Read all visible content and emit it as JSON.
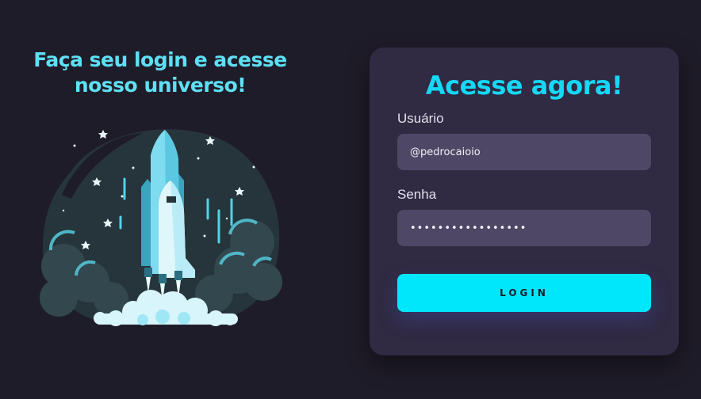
{
  "left": {
    "headline_line1": "Faça seu login e acesse",
    "headline_line2": "nosso universo!",
    "illustration_icon": "rocket-launch-illustration"
  },
  "login_card": {
    "title": "Acesse agora!",
    "username_label": "Usuário",
    "username_value": "@pedrocaioio",
    "password_label": "Senha",
    "password_value": "•••••••••••••••••",
    "login_button": "LOGIN"
  },
  "colors": {
    "background": "#1f1c29",
    "card": "#302a43",
    "accent": "#00e7fb",
    "headline": "#5ee0f4",
    "input": "#4f4766"
  }
}
